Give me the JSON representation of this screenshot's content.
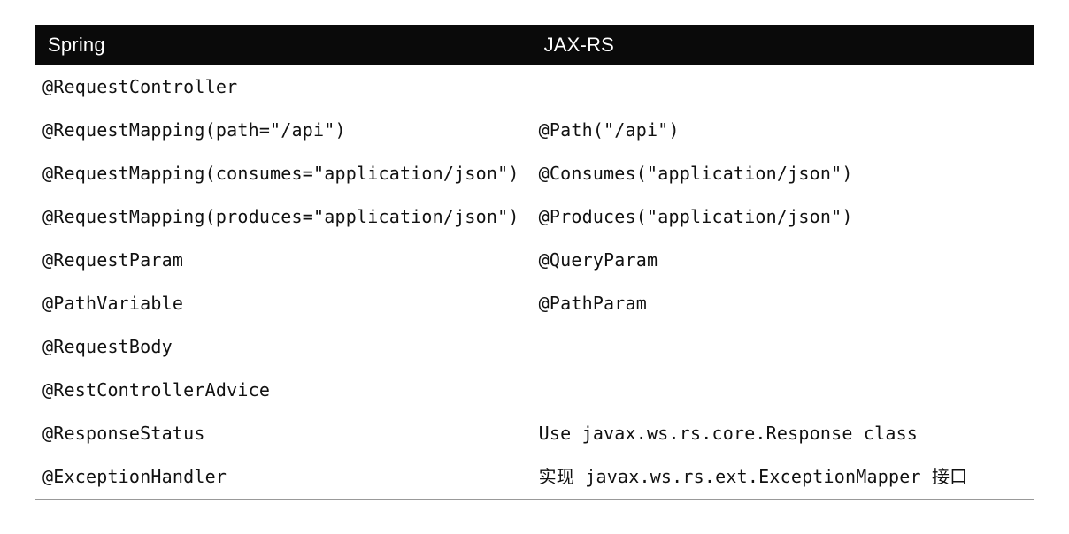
{
  "table": {
    "headers": {
      "spring": "Spring",
      "jaxrs": "JAX-RS"
    },
    "rows": [
      {
        "spring": "@RequestController",
        "jaxrs": ""
      },
      {
        "spring": "@RequestMapping(path=\"/api\")",
        "jaxrs": "@Path(\"/api\")"
      },
      {
        "spring": "@RequestMapping(consumes=\"application/json\")",
        "jaxrs": "@Consumes(\"application/json\")"
      },
      {
        "spring": "@RequestMapping(produces=\"application/json\")",
        "jaxrs": "@Produces(\"application/json\")"
      },
      {
        "spring": "@RequestParam",
        "jaxrs": "@QueryParam"
      },
      {
        "spring": "@PathVariable",
        "jaxrs": "@PathParam"
      },
      {
        "spring": "@RequestBody",
        "jaxrs": ""
      },
      {
        "spring": "@RestControllerAdvice",
        "jaxrs": ""
      },
      {
        "spring": "@ResponseStatus",
        "jaxrs": "Use javax.ws.rs.core.Response class"
      },
      {
        "spring": "@ExceptionHandler",
        "jaxrs": "实现 javax.ws.rs.ext.ExceptionMapper 接口"
      }
    ]
  }
}
